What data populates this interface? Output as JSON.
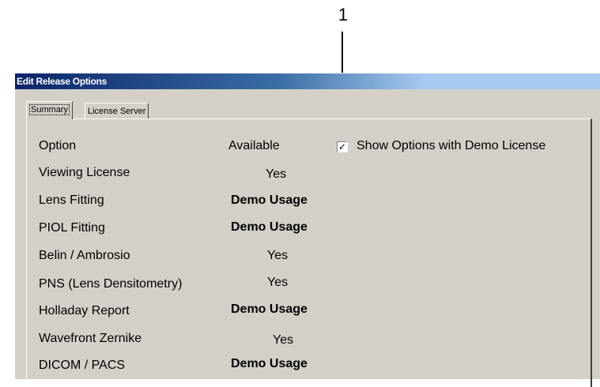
{
  "callout": {
    "number": "1"
  },
  "window": {
    "title": "Edit Release Options"
  },
  "tabs": [
    {
      "label": "Summary",
      "active": true
    },
    {
      "label": "License Server",
      "active": false
    }
  ],
  "table": {
    "headers": {
      "option": "Option",
      "available": "Available"
    },
    "rows": [
      {
        "option": "Viewing License",
        "available": "Yes"
      },
      {
        "option": "Lens Fitting",
        "available": "Demo Usage"
      },
      {
        "option": "PIOL Fitting",
        "available": "Demo Usage"
      },
      {
        "option": "Belin / Ambrosio",
        "available": "Yes"
      },
      {
        "option": "PNS (Lens Densitometry)",
        "available": "Yes"
      },
      {
        "option": "Holladay Report",
        "available": "Demo Usage"
      },
      {
        "option": "Wavefront Zernike",
        "available": "Yes"
      },
      {
        "option": "DICOM / PACS",
        "available": "Demo Usage"
      }
    ]
  },
  "show_demo_checkbox": {
    "label": "Show Options with Demo License",
    "checked": true,
    "mark": "✓"
  },
  "colors": {
    "window_bg": "#d4d0c8",
    "titlebar_start": "#0a246a",
    "titlebar_end": "#a6caf0"
  }
}
